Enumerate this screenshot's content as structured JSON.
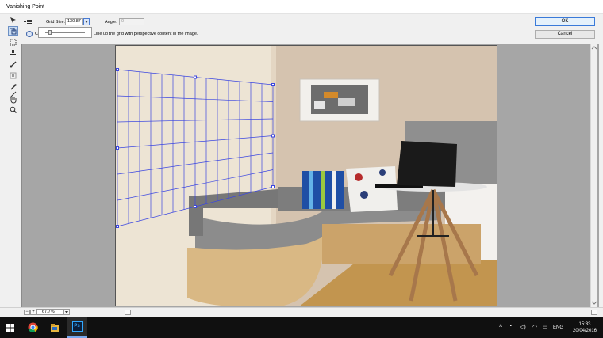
{
  "window": {
    "title": "Vanishing Point"
  },
  "options": {
    "grid_size_label": "Grid Size:",
    "grid_size_value": "130.87",
    "angle_label": "Angle:",
    "angle_value": "0",
    "tip_prefix": "C",
    "tip_text": "Line up the grid with perspective content in the image."
  },
  "buttons": {
    "ok": "OK",
    "cancel": "Cancel"
  },
  "tools": [
    "edit-plane-tool",
    "create-plane-tool",
    "marquee-tool",
    "stamp-tool",
    "brush-tool",
    "transform-tool",
    "eyedropper-tool",
    "measure-tool",
    "hand-tool",
    "zoom-tool"
  ],
  "status": {
    "zoom": "67.7%",
    "zoom_out": "−",
    "zoom_in": "+"
  },
  "taskbar": {
    "apps": [
      "start-icon",
      "chrome-icon",
      "file-explorer-icon",
      "photoshop-icon"
    ],
    "photoshop_label": "Ps",
    "language": "ENG",
    "time": "15:33",
    "date": "20/04/2016"
  },
  "colors": {
    "grid": "#3b46e0",
    "accent": "#3a7ad9",
    "taskbar": "#101010"
  }
}
